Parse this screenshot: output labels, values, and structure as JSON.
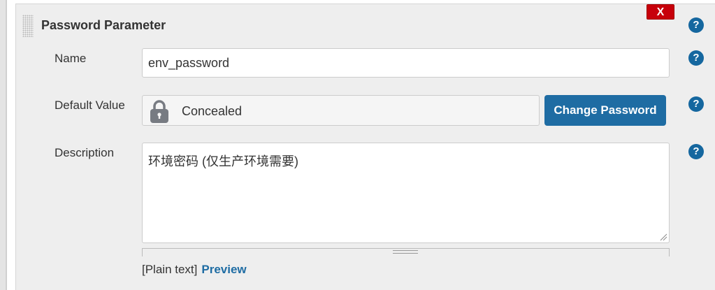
{
  "section": {
    "title": "Password Parameter",
    "delete_label": "X"
  },
  "fields": {
    "name": {
      "label": "Name",
      "value": "env_password"
    },
    "default_value": {
      "label": "Default Value",
      "concealed_text": "Concealed",
      "change_button": "Change Password"
    },
    "description": {
      "label": "Description",
      "value": "环境密码 (仅生产环境需要)"
    }
  },
  "markup": {
    "format_label": "[Plain text]",
    "preview_label": "Preview"
  },
  "help_icon_glyph": "?",
  "colors": {
    "accent": "#1e6ca3",
    "help": "#15679f",
    "delete": "#c7000b",
    "panel_bg": "#eeeeee"
  }
}
